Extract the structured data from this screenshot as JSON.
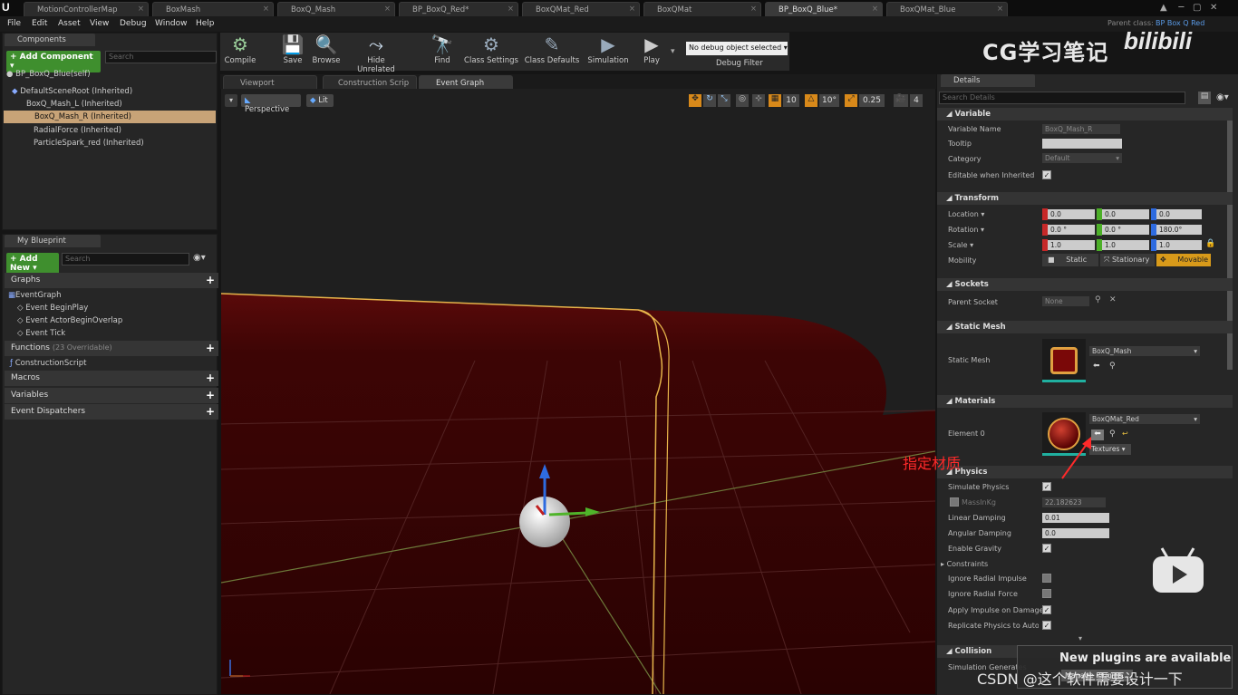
{
  "tabs": [
    {
      "label": "MotionControllerMap"
    },
    {
      "label": "BoxMash"
    },
    {
      "label": "BoxQ_Mash"
    },
    {
      "label": "BP_BoxQ_Red*"
    },
    {
      "label": "BoxQMat_Red"
    },
    {
      "label": "BoxQMat"
    },
    {
      "label": "BP_BoxQ_Blue*"
    },
    {
      "label": "BoxQMat_Blue"
    }
  ],
  "menu": [
    "File",
    "Edit",
    "Asset",
    "View",
    "Debug",
    "Window",
    "Help"
  ],
  "parent_class": {
    "label": "Parent class:",
    "value": "BP Box Q Red"
  },
  "components": {
    "tab": "Components",
    "add_button": "+ Add Component ▾",
    "search_placeholder": "Search",
    "self": "BP_BoxQ_Blue(self)",
    "items": [
      "DefaultSceneRoot (Inherited)",
      "BoxQ_Mash_L (Inherited)",
      "BoxQ_Mash_R (Inherited)",
      "RadialForce (Inherited)",
      "ParticleSpark_red (Inherited)"
    ]
  },
  "my_blueprint": {
    "tab": "My Blueprint",
    "add_new": "+ Add New ▾",
    "search_placeholder": "Search",
    "graphs_label": "Graphs",
    "graph_items": [
      "EventGraph",
      "Event BeginPlay",
      "Event ActorBeginOverlap",
      "Event Tick"
    ],
    "functions_label": "Functions",
    "functions_note": "(23 Overridable)",
    "function_items": [
      "ConstructionScript"
    ],
    "macros": "Macros",
    "variables": "Variables",
    "dispatchers": "Event Dispatchers"
  },
  "toolbar": {
    "compile": "Compile",
    "save": "Save",
    "browse": "Browse",
    "hide_unrelated": "Hide Unrelated",
    "find": "Find",
    "class_settings": "Class Settings",
    "class_defaults": "Class Defaults",
    "simulation": "Simulation",
    "play": "Play",
    "debug_selected": "No debug object selected ▾",
    "debug_filter": "Debug Filter"
  },
  "editor_tabs": [
    "Viewport",
    "Construction Scrip",
    "Event Graph"
  ],
  "viewport": {
    "perspective": "Perspective",
    "lit": "Lit",
    "grid_snap": "10",
    "rot_snap": "10°",
    "scale_snap": "0.25",
    "cam_speed": "4"
  },
  "details": {
    "tab": "Details",
    "search_placeholder": "Search Details",
    "variable_section": "Variable",
    "variable_name_label": "Variable Name",
    "variable_name": "BoxQ_Mash_R",
    "tooltip_label": "Tooltip",
    "category_label": "Category",
    "category": "Default",
    "editable_label": "Editable when Inherited",
    "transform_section": "Transform",
    "location_label": "Location ▾",
    "location": [
      "0.0",
      "0.0",
      "0.0"
    ],
    "rotation_label": "Rotation ▾",
    "rotation": [
      "0.0 °",
      "0.0 °",
      "180.0°"
    ],
    "scale_label": "Scale ▾",
    "scale": [
      "1.0",
      "1.0",
      "1.0"
    ],
    "mobility_label": "Mobility",
    "mobility_options": [
      "Static",
      "Stationary",
      "Movable"
    ],
    "sockets_section": "Sockets",
    "parent_socket_label": "Parent Socket",
    "parent_socket": "None",
    "static_mesh_section": "Static Mesh",
    "static_mesh_label": "Static Mesh",
    "static_mesh": "BoxQ_Mash",
    "materials_section": "Materials",
    "element0_label": "Element 0",
    "element0": "BoxQMat_Red",
    "textures": "Textures ▾",
    "physics_section": "Physics",
    "simulate_physics": "Simulate Physics",
    "mass_label": "MassInKg",
    "mass": "22.182623",
    "linear_damping_label": "Linear Damping",
    "linear_damping": "0.01",
    "angular_damping_label": "Angular Damping",
    "angular_damping": "0.0",
    "enable_gravity": "Enable Gravity",
    "constraints": "Constraints",
    "ignore_radial_impulse": "Ignore Radial Impulse",
    "ignore_radial_force": "Ignore Radial Force",
    "apply_impulse": "Apply Impulse on Damage",
    "replicate_physics": "Replicate Physics to Autono",
    "collision_section": "Collision",
    "simulation_generates": "Simulation Generates"
  },
  "annotation": "指定材质",
  "notification": {
    "title": "New plugins are available",
    "button": "Manage Plugins..."
  },
  "watermarks": {
    "top": "CG学习笔记",
    "brand": "bilibili",
    "bottom": "CSDN @这个软件需要设计一下"
  },
  "colors": {
    "accent": "#c8a377",
    "green": "#3f8f2e",
    "movable": "#d89a1a",
    "red_mesh": "#3a0404",
    "annotation": "#ff2a2a"
  }
}
